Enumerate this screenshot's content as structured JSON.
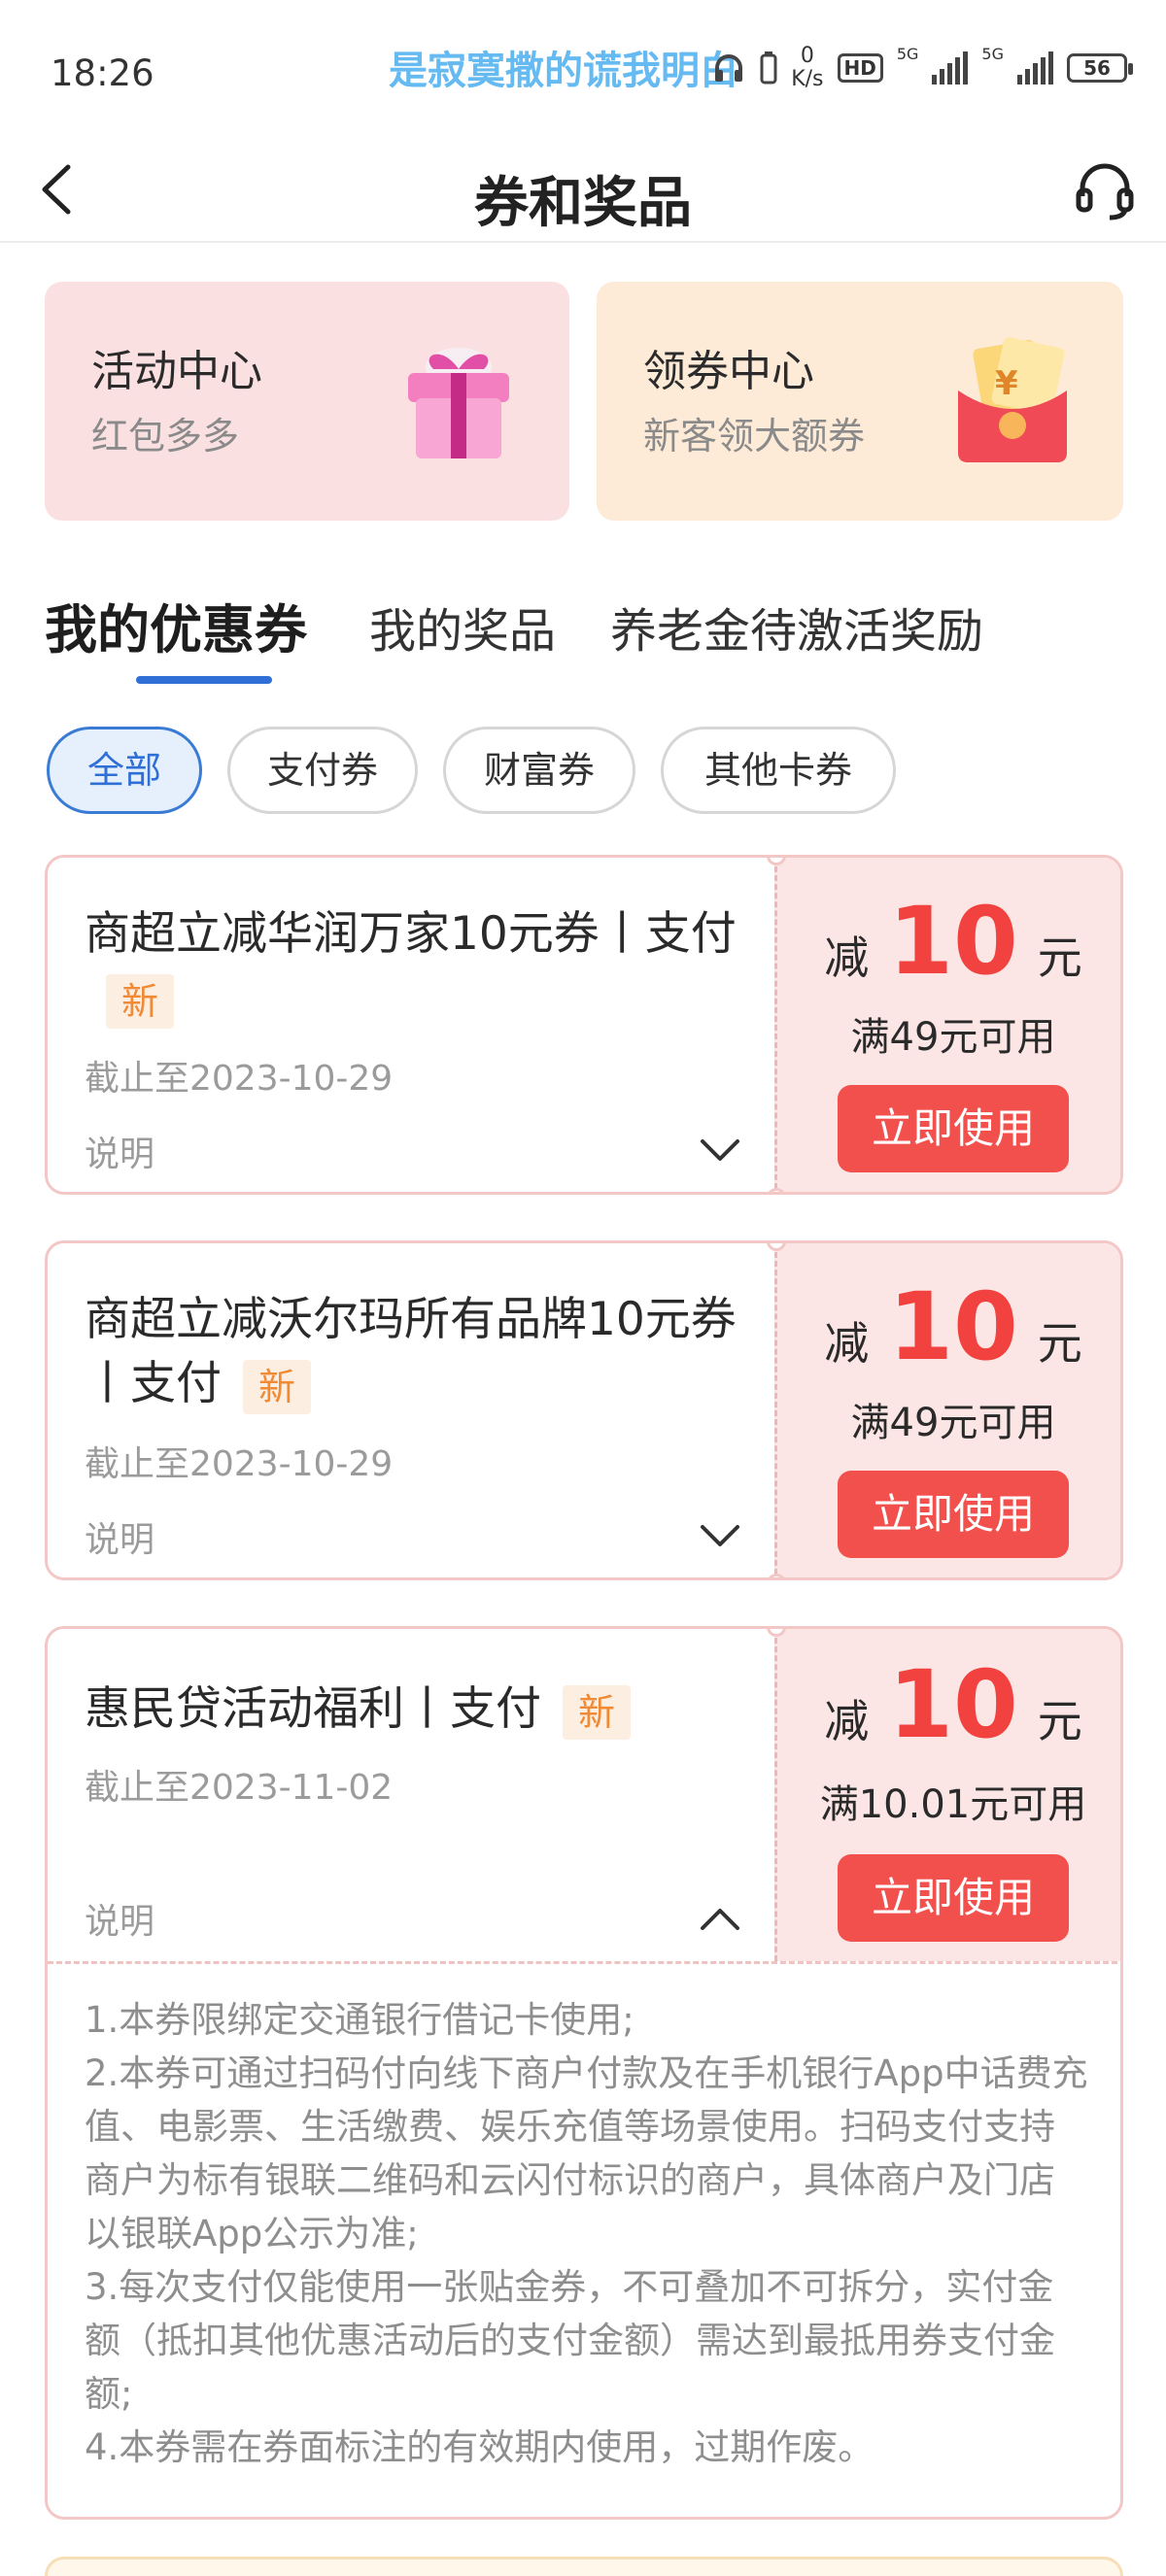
{
  "status_bar": {
    "time": "18:26",
    "ticker": "是寂寞撒的谎我明白",
    "net_speed_value": "0",
    "net_speed_unit": "K/s",
    "hd": "HD",
    "sim1": "5G",
    "sim2": "5G",
    "battery": "56"
  },
  "header": {
    "title": "券和奖品",
    "back_icon": "back-arrow-icon",
    "service_icon": "headset-icon"
  },
  "promos": [
    {
      "title": "活动中心",
      "subtitle": "红包多多",
      "icon": "gift-box-icon",
      "bg": "#fbe0e2"
    },
    {
      "title": "领券中心",
      "subtitle": "新客领大额券",
      "icon": "red-envelope-icon",
      "bg": "#fdebd8"
    }
  ],
  "tabs": [
    {
      "label": "我的优惠券",
      "active": true
    },
    {
      "label": "我的奖品",
      "active": false
    },
    {
      "label": "养老金待激活奖励",
      "active": false
    }
  ],
  "filters": [
    {
      "label": "全部",
      "active": true
    },
    {
      "label": "支付券",
      "active": false
    },
    {
      "label": "财富券",
      "active": false
    },
    {
      "label": "其他卡券",
      "active": false
    }
  ],
  "coupons": [
    {
      "title": "商超立减华润万家10元券丨支付",
      "badge": "新",
      "expiry": "截止至2023-10-29",
      "note_label": "说明",
      "prefix": "减",
      "amount": "10",
      "unit": "元",
      "threshold": "满49元可用",
      "button": "立即使用",
      "expanded": false
    },
    {
      "title": "商超立减沃尔玛所有品牌10元券丨支付",
      "badge": "新",
      "expiry": "截止至2023-10-29",
      "note_label": "说明",
      "prefix": "减",
      "amount": "10",
      "unit": "元",
      "threshold": "满49元可用",
      "button": "立即使用",
      "expanded": false
    },
    {
      "title": "惠民贷活动福利丨支付",
      "badge": "新",
      "expiry": "截止至2023-11-02",
      "note_label": "说明",
      "prefix": "减",
      "amount": "10",
      "unit": "元",
      "threshold": "满10.01元可用",
      "button": "立即使用",
      "expanded": true,
      "details": [
        "1.本券限绑定交通银行借记卡使用;",
        "2.本券可通过扫码付向线下商户付款及在手机银行App中话费充值、电影票、生活缴费、娱乐充值等场景使用。扫码支付支持商户为标有银联二维码和云闪付标识的商户，具体商户及门店以银联App公示为准;",
        "3.每次支付仅能使用一张贴金券，不可叠加不可拆分，实付金额（抵扣其他优惠活动后的支付金额）需达到最抵用券支付金额;",
        "4.本券需在券面标注的有效期内使用，过期作废。"
      ]
    }
  ],
  "colors": {
    "accent_blue": "#2f6fd6",
    "coupon_red": "#f2423f",
    "button_red": "#f2504c",
    "badge_orange": "#f08a35"
  }
}
